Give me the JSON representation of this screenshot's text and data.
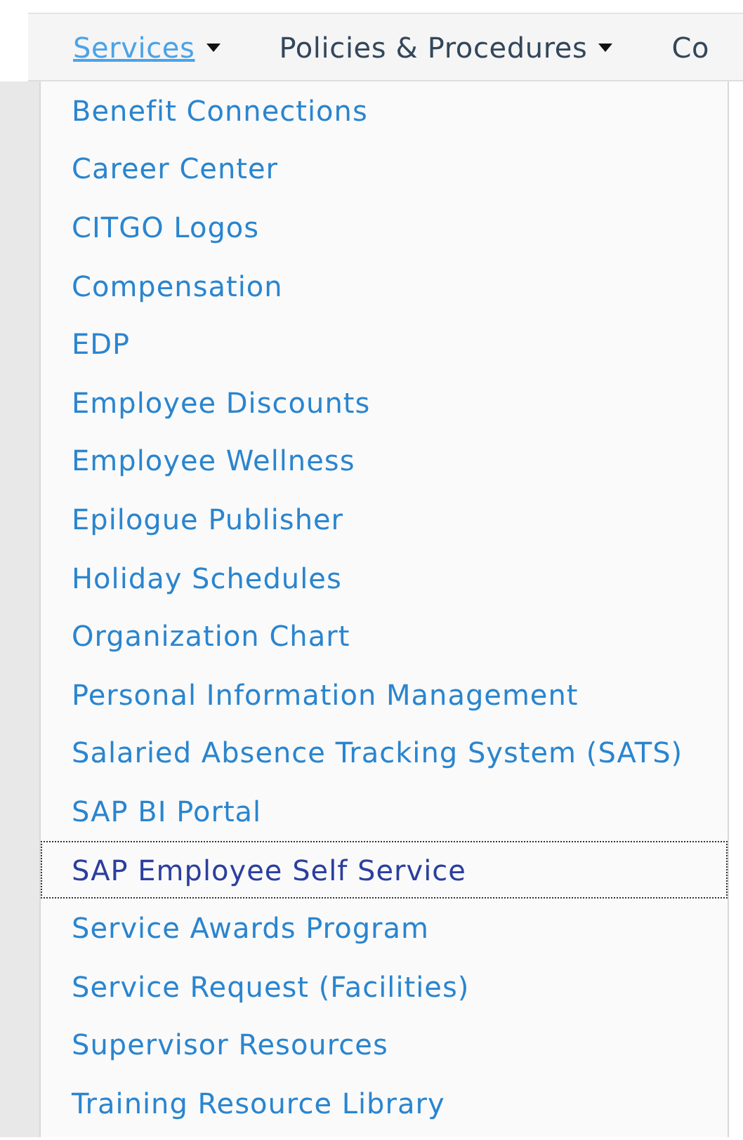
{
  "nav": [
    {
      "label": "Services",
      "selected": true,
      "has_caret": true
    },
    {
      "label": "Policies & Procedures",
      "selected": false,
      "has_caret": true
    },
    {
      "label": "Co",
      "selected": false,
      "has_caret": false
    }
  ],
  "dropdown": {
    "items": [
      {
        "label": "Benefit Connections",
        "focused": false
      },
      {
        "label": "Career Center",
        "focused": false
      },
      {
        "label": "CITGO Logos",
        "focused": false
      },
      {
        "label": "Compensation",
        "focused": false
      },
      {
        "label": "EDP",
        "focused": false
      },
      {
        "label": "Employee Discounts",
        "focused": false
      },
      {
        "label": "Employee Wellness",
        "focused": false
      },
      {
        "label": "Epilogue Publisher",
        "focused": false
      },
      {
        "label": "Holiday Schedules",
        "focused": false
      },
      {
        "label": "Organization Chart",
        "focused": false
      },
      {
        "label": "Personal Information Management",
        "focused": false
      },
      {
        "label": "Salaried Absence Tracking System (SATS)",
        "focused": false
      },
      {
        "label": "SAP BI Portal",
        "focused": false
      },
      {
        "label": "SAP Employee Self Service",
        "focused": true
      },
      {
        "label": "Service Awards Program",
        "focused": false
      },
      {
        "label": "Service Request (Facilities)",
        "focused": false
      },
      {
        "label": "Supervisor Resources",
        "focused": false
      },
      {
        "label": "Training Resource Library",
        "focused": false
      }
    ]
  }
}
